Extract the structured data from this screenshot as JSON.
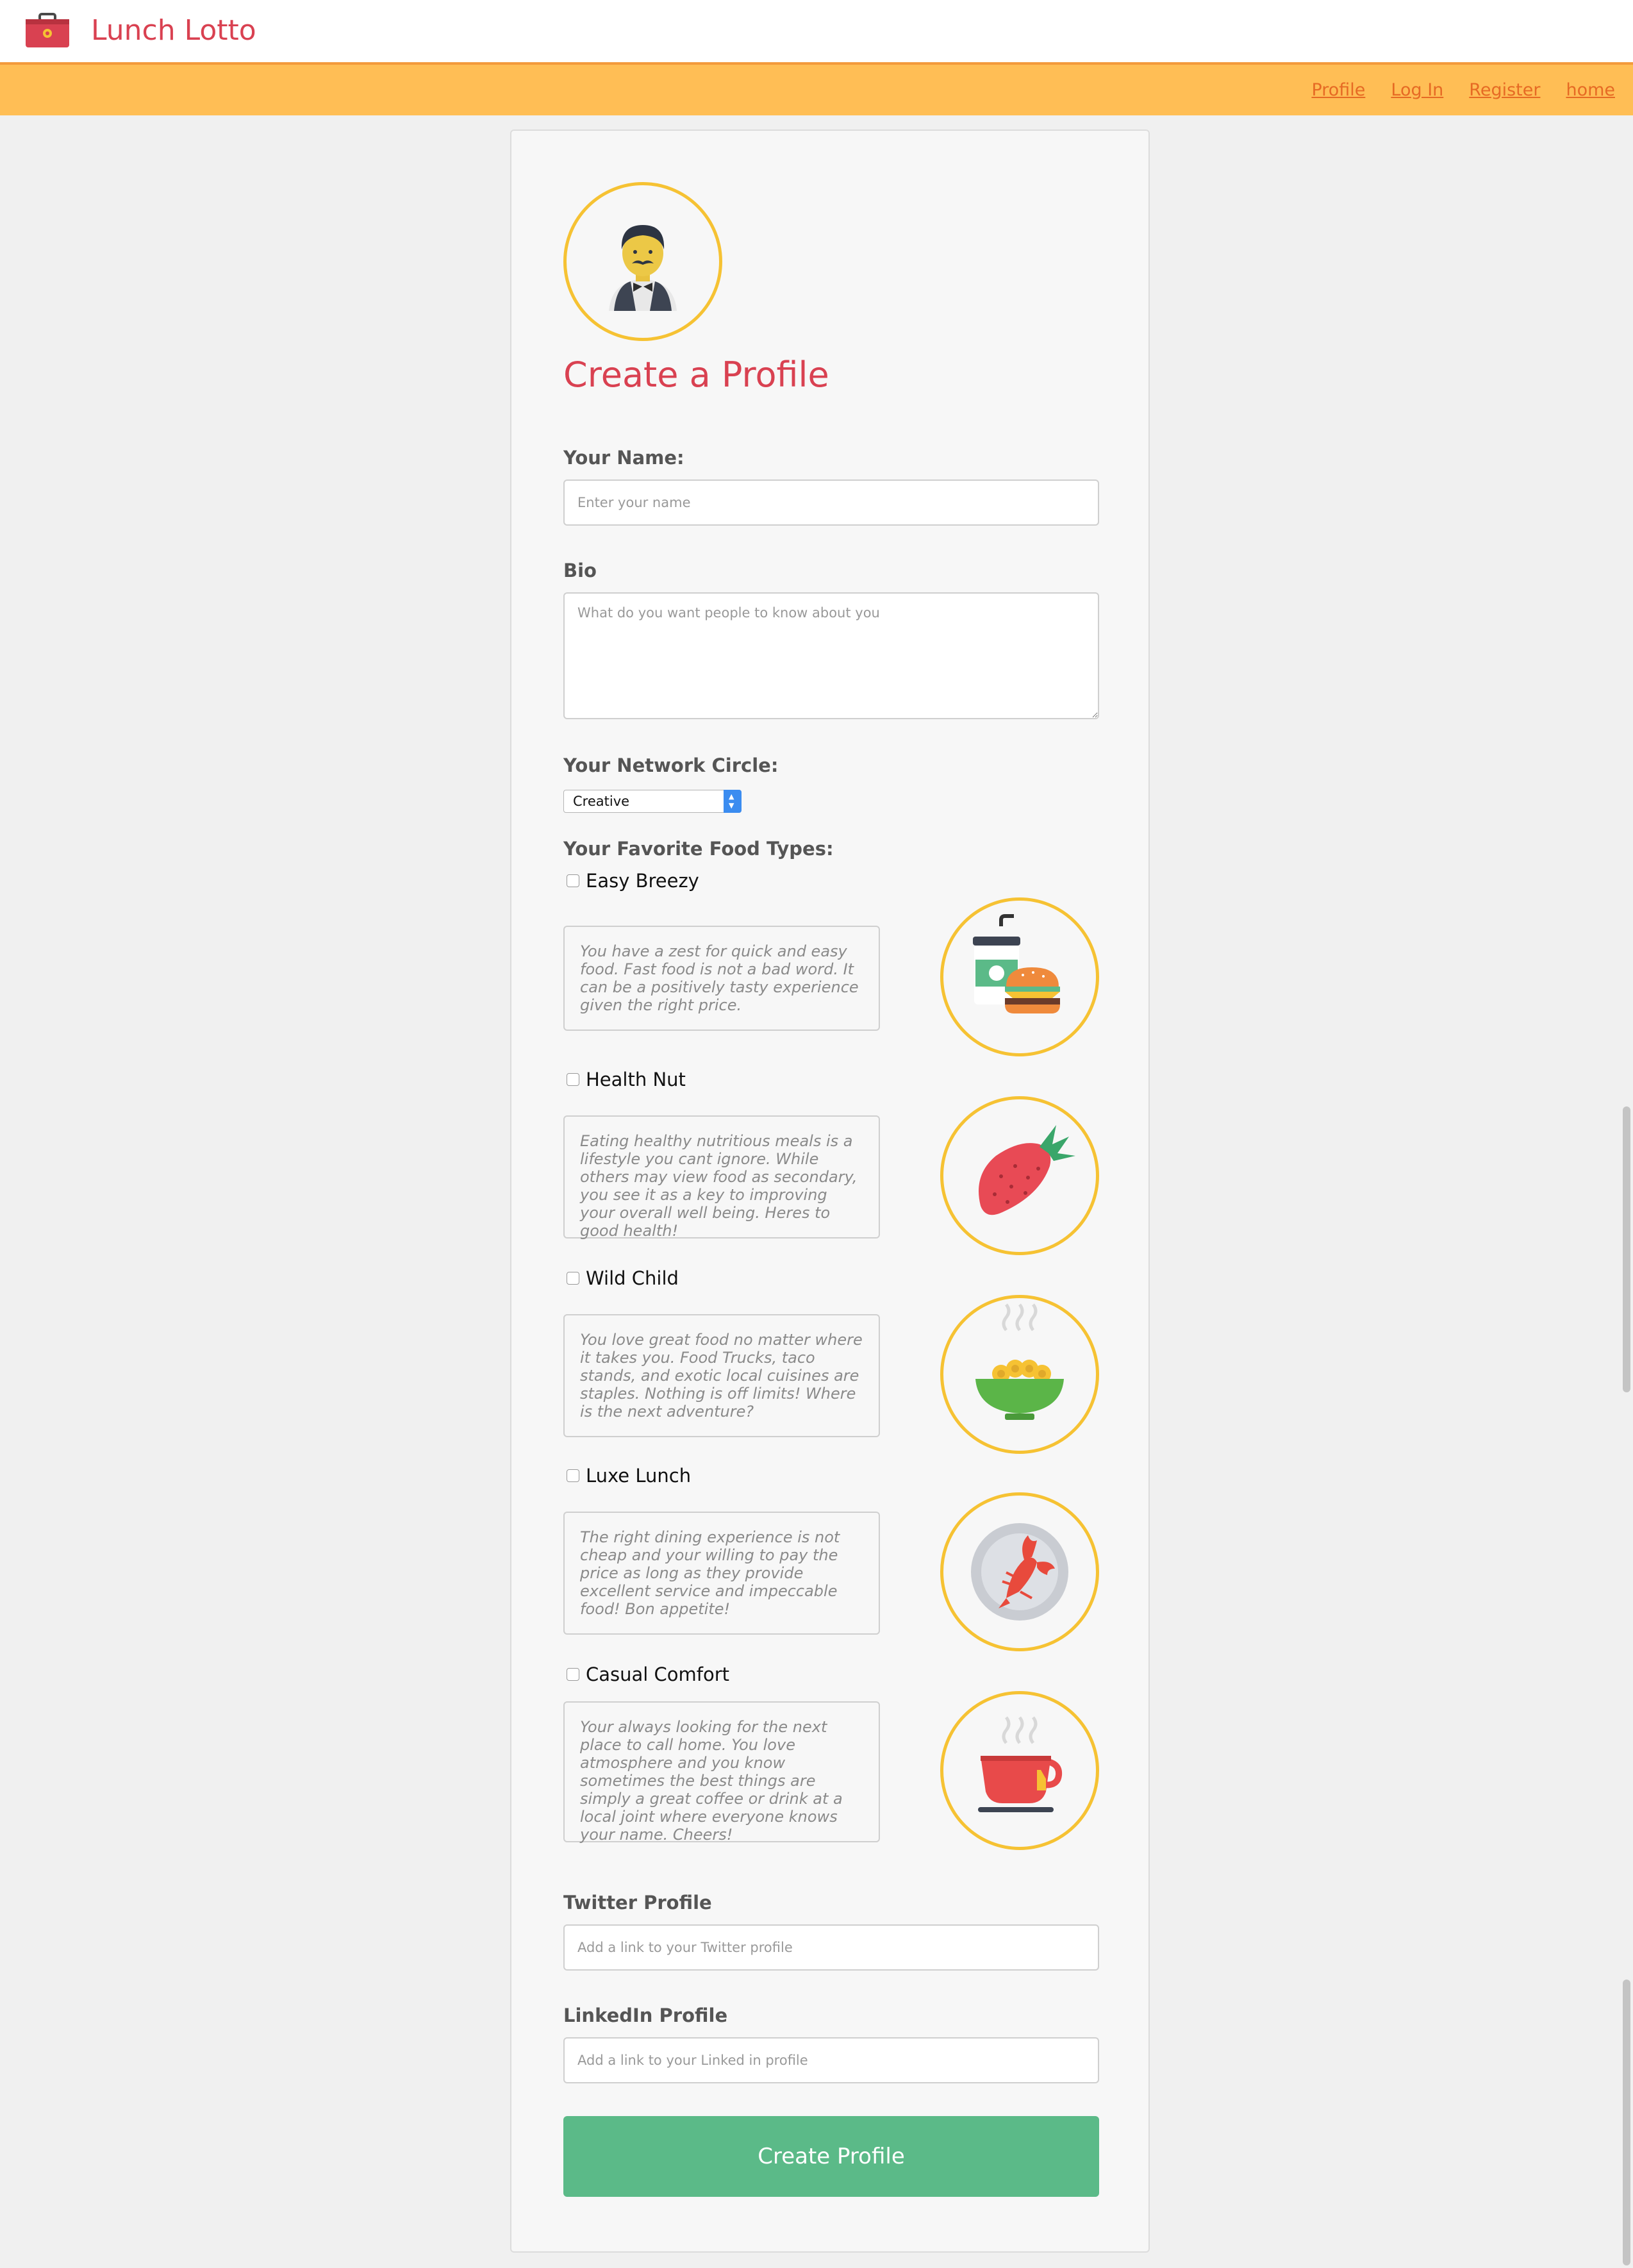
{
  "app": {
    "title": "Lunch Lotto",
    "brand_icon": "lunchbox-icon",
    "brand_color": "#d94151"
  },
  "nav": {
    "links": [
      "Profile",
      "Log In",
      "Register",
      "home"
    ],
    "bar_color": "#ffbe55",
    "link_color": "#e66a24"
  },
  "form": {
    "avatar_icon": "waiter-icon",
    "title": "Create a Profile",
    "name": {
      "label": "Your Name:",
      "placeholder": "Enter your name",
      "value": ""
    },
    "bio": {
      "label": "Bio",
      "placeholder": "What do you want people to know about you",
      "value": ""
    },
    "network": {
      "label": "Your Network Circle:",
      "selected": "Creative"
    },
    "food_label": "Your Favorite Food Types:",
    "foods": [
      {
        "name": "Easy Breezy",
        "checked": false,
        "icon": "burger-drink-icon",
        "description": "You have a zest for quick and easy food. Fast food is not a bad word. It can be a positively tasty experience given the right price."
      },
      {
        "name": "Health Nut",
        "checked": false,
        "icon": "strawberry-icon",
        "description": "Eating healthy nutritious meals is a lifestyle you cant ignore. While others may view food as secondary, you see it as a key to improving your overall well being. Heres to good health!"
      },
      {
        "name": "Wild Child",
        "checked": false,
        "icon": "noodle-bowl-icon",
        "description": "You love great food no matter where it takes you. Food Trucks, taco stands, and exotic local cuisines are staples. Nothing is off limits! Where is the next adventure?"
      },
      {
        "name": "Luxe Lunch",
        "checked": false,
        "icon": "lobster-plate-icon",
        "description": "The right dining experience is not cheap and your willing to pay the price as long as they provide excellent service and impeccable food! Bon appetite!"
      },
      {
        "name": "Casual Comfort",
        "checked": false,
        "icon": "coffee-cup-icon",
        "description": "Your always looking for the next place to call home. You love atmosphere and you know sometimes the best things are simply a great coffee or drink at a local joint where everyone knows your name. Cheers!"
      }
    ],
    "twitter": {
      "label": "Twitter Profile",
      "placeholder": "Add a link to your Twitter profile",
      "value": ""
    },
    "linkedin": {
      "label": "LinkedIn Profile",
      "placeholder": "Add a link to your Linked in profile",
      "value": ""
    },
    "submit_label": "Create Profile",
    "submit_color": "#5bba88",
    "accent_color": "#f6c233"
  }
}
